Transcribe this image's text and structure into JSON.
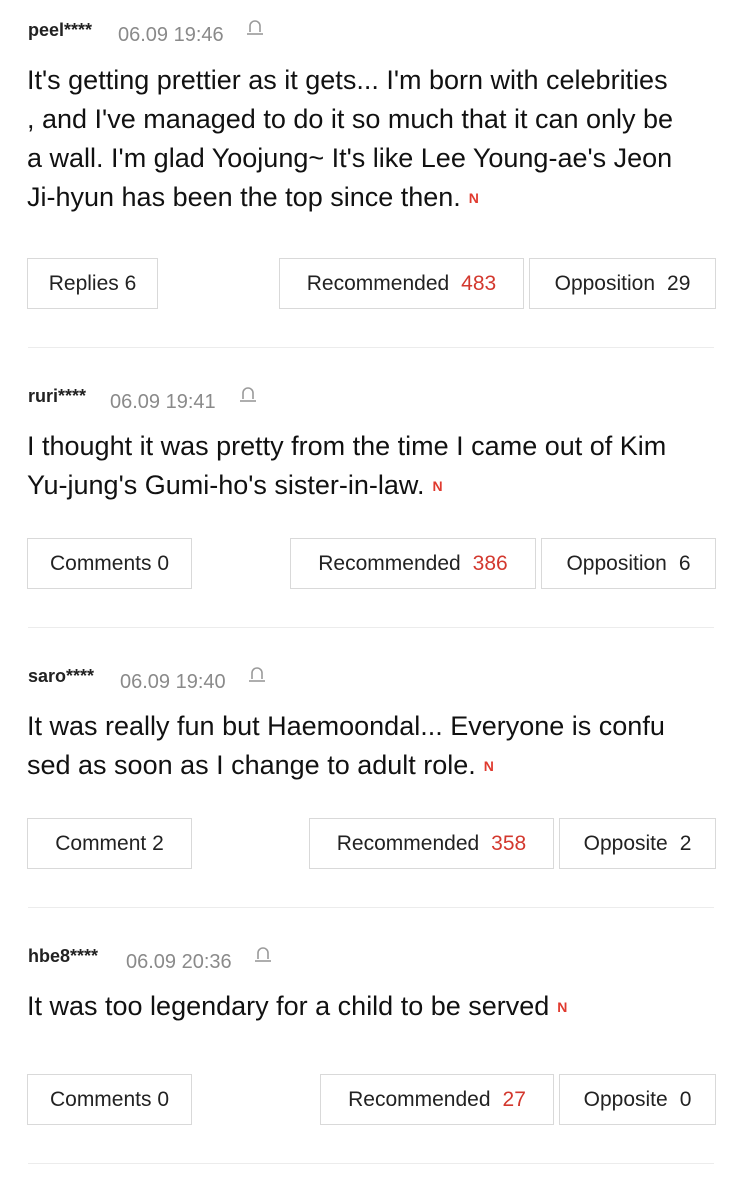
{
  "n_badge": "N",
  "comments": [
    {
      "author": "peel****",
      "time": "06.09 19:46",
      "lines": [
        "It's getting prettier as it gets... I'm born with celebrities",
        ", and I've managed to do it so much that it can only be",
        "a wall. I'm glad Yoojung~ It's like Lee Young-ae's Jeon",
        "Ji-hyun has been the top since then."
      ],
      "replies_label": "Replies 6",
      "recommend_label": "Recommended",
      "recommend_count": "483",
      "oppose_label": "Opposition",
      "oppose_count": "29"
    },
    {
      "author": "ruri****",
      "time": "06.09 19:41",
      "lines": [
        "I thought it was pretty from the time I came out of Kim",
        "Yu-jung's Gumi-ho's sister-in-law."
      ],
      "replies_label": "Comments 0",
      "recommend_label": "Recommended",
      "recommend_count": "386",
      "oppose_label": "Opposition",
      "oppose_count": "6"
    },
    {
      "author": "saro****",
      "time": "06.09 19:40",
      "lines": [
        "It was really fun but Haemoondal... Everyone is confu",
        "sed as soon as I change to adult role."
      ],
      "replies_label": "Comment 2",
      "recommend_label": "Recommended",
      "recommend_count": "358",
      "oppose_label": "Opposite",
      "oppose_count": "2"
    },
    {
      "author": "hbe8****",
      "time": "06.09 20:36",
      "lines": [
        "It was too legendary for a child to be served"
      ],
      "replies_label": "Comments 0",
      "recommend_label": "Recommended",
      "recommend_count": "27",
      "oppose_label": "Opposite",
      "oppose_count": "0"
    }
  ]
}
